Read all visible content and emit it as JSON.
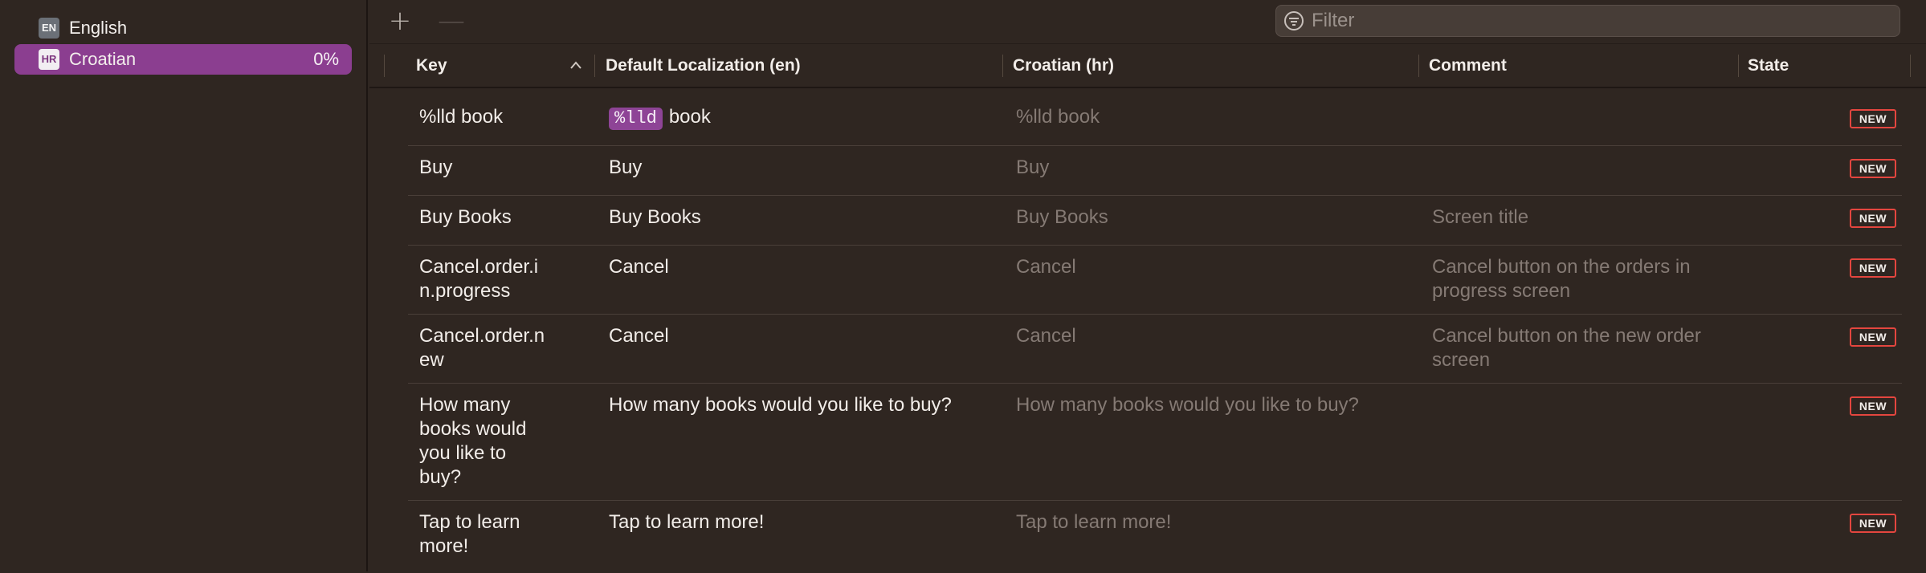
{
  "sidebar": {
    "languages": [
      {
        "code": "EN",
        "name": "English",
        "progress": ""
      },
      {
        "code": "HR",
        "name": "Croatian",
        "progress": "0%"
      }
    ]
  },
  "toolbar": {
    "add_icon": "plus-icon",
    "remove_icon": "minus-icon",
    "add_label": "+",
    "remove_label": "—",
    "filter_placeholder": "Filter"
  },
  "table": {
    "columns": [
      "Key",
      "Default Localization (en)",
      "Croatian (hr)",
      "Comment",
      "State"
    ],
    "sort": "ascending",
    "rows": [
      {
        "key": "%lld book",
        "default_token": "%lld",
        "default": "book",
        "croatian": "%lld book",
        "comment": "",
        "state": "NEW"
      },
      {
        "key": "Buy",
        "default": "Buy",
        "croatian": "Buy",
        "comment": "",
        "state": "NEW"
      },
      {
        "key": "Buy Books",
        "default": "Buy Books",
        "croatian": "Buy Books",
        "comment": "Screen title",
        "state": "NEW"
      },
      {
        "key": "Cancel.order.in.progress",
        "default": "Cancel",
        "croatian": "Cancel",
        "comment": "Cancel button on the orders in progress screen",
        "state": "NEW"
      },
      {
        "key": "Cancel.order.new",
        "default": "Cancel",
        "croatian": "Cancel",
        "comment": "Cancel button on the new order screen",
        "state": "NEW"
      },
      {
        "key": "How many books would you like to buy?",
        "default": "How many books would you like to buy?",
        "croatian": "How many books would you like to buy?",
        "comment": "",
        "state": "NEW"
      },
      {
        "key": "Tap to learn more!",
        "default": "Tap to learn more!",
        "croatian": "Tap to learn more!",
        "comment": "",
        "state": "NEW"
      }
    ]
  },
  "colors": {
    "background": "#2f2621",
    "accent": "#8b3e90",
    "new_badge": "#e4463f"
  }
}
